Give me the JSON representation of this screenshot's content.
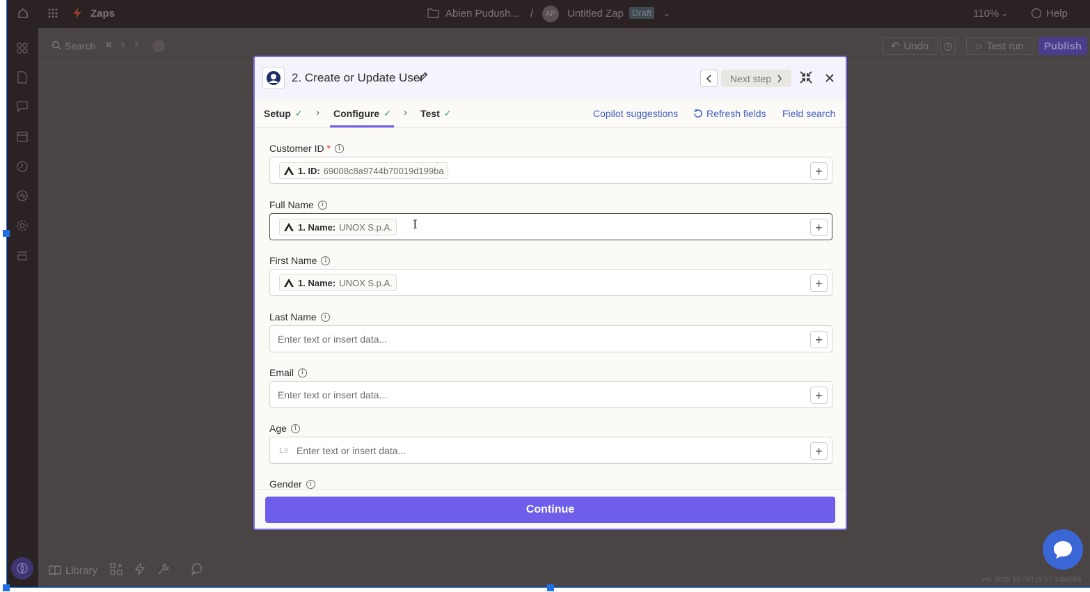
{
  "topbar": {
    "product": "Zaps",
    "folder": "Abien Pudush...",
    "separator": "/",
    "avatar_initials": "AP",
    "zap_name": "Untitled Zap",
    "status_badge": "Draft",
    "zoom": "110%",
    "help": "Help"
  },
  "canvas_toolbar": {
    "search_label": "Search",
    "shortcut_keys": [
      "⌘",
      "⇧",
      "F"
    ],
    "undo_label": "Undo",
    "test_run_label": "Test run",
    "publish_label": "Publish"
  },
  "bottom_tools": {
    "library_label": "Library"
  },
  "version_text": "ver. 2025-10-28T15:57-136d954",
  "modal": {
    "title": "2. Create or Update User",
    "next_step_label": "Next step",
    "tabs": [
      {
        "label": "Setup",
        "done": true
      },
      {
        "label": "Configure",
        "done": true
      },
      {
        "label": "Test",
        "done": true
      }
    ],
    "links": {
      "copilot": "Copilot suggestions",
      "refresh": "Refresh fields",
      "field_search": "Field search"
    },
    "fields": [
      {
        "label": "Customer ID",
        "required": "*",
        "pill_key": "1. ID:",
        "pill_value": "69008c8a9744b70019d199ba"
      },
      {
        "label": "Full Name",
        "pill_key": "1. Name:",
        "pill_value": "UNOX S.p.A."
      },
      {
        "label": "First Name",
        "pill_key": "1. Name:",
        "pill_value": "UNOX S.p.A."
      },
      {
        "label": "Last Name",
        "placeholder": "Enter text or insert data..."
      },
      {
        "label": "Email",
        "placeholder": "Enter text or insert data..."
      },
      {
        "label": "Age",
        "type_hint": "1.0",
        "placeholder": "Enter text or insert data..."
      },
      {
        "label": "Gender"
      }
    ],
    "continue_label": "Continue"
  },
  "colors": {
    "accent": "#6e5eea",
    "link": "#3f5fbf",
    "success": "#2f9a52",
    "required": "#d6402e"
  }
}
